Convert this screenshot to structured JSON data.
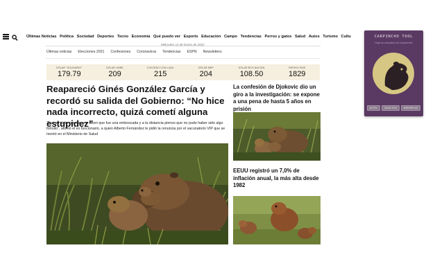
{
  "nav": {
    "links": [
      "Últimas Noticias",
      "Política",
      "Sociedad",
      "Deportes",
      "Tecno",
      "Economía",
      "Qué puedo ver",
      "Esports",
      "Educación",
      "Campo",
      "Tendencias",
      "Perros y gatos",
      "Salud",
      "Autos",
      "Turismo",
      "Cultu"
    ]
  },
  "date": "Miércoles 12 de Enero de 2022",
  "subnav": [
    "Últimas noticias",
    "Elecciones 2021",
    "Confesiones",
    "Coronavirus",
    "Tendencias",
    "ESPN",
    "Newsletters"
  ],
  "ticker": [
    {
      "label": "Dólar \"solidario\"",
      "value": "179.79"
    },
    {
      "label": "Dólar libre",
      "value": "209"
    },
    {
      "label": "Contado con liqui",
      "value": "215"
    },
    {
      "label": "Dólar MEP",
      "value": "204"
    },
    {
      "label": "Dólar BCO Nación",
      "value": "108.50"
    },
    {
      "label": "Riesgo país",
      "value": "1829"
    }
  ],
  "main": {
    "headline": "Reapareció Ginés González García y recordó su salida del Gobierno: “No hice nada incorrecto, quizá cometí alguna estupidez”",
    "lede": "“Fue un dolor grande, me dicen que fue una emboscada y a la distancia pienso que no pudo haber sido algo fortuito”, afirmó el ex funcionario, a quien Alberto Fernández le pidió la renuncia por el vacunatorio VIP que se montó en el Ministerio de Salud"
  },
  "side": [
    {
      "headline": "La confesión de Djokovic dio un giro a la investigación: se expone a una pena de hasta 5 años en prisión"
    },
    {
      "headline": "EEUU registró un 7,0% de inflación anual, la más alta desde 1982"
    }
  ],
  "popup": {
    "title": "CARPINCHO TOOL",
    "subtitle": "Hoja no actualiza de Carpinchos",
    "buttons": [
      "Activ",
      "Ocultos",
      "Reemplaz"
    ]
  },
  "colors": {
    "popup_bg": "#5a3a63",
    "ticker_bg": "#f6efdf",
    "emblem_fill": "#d6c784"
  }
}
